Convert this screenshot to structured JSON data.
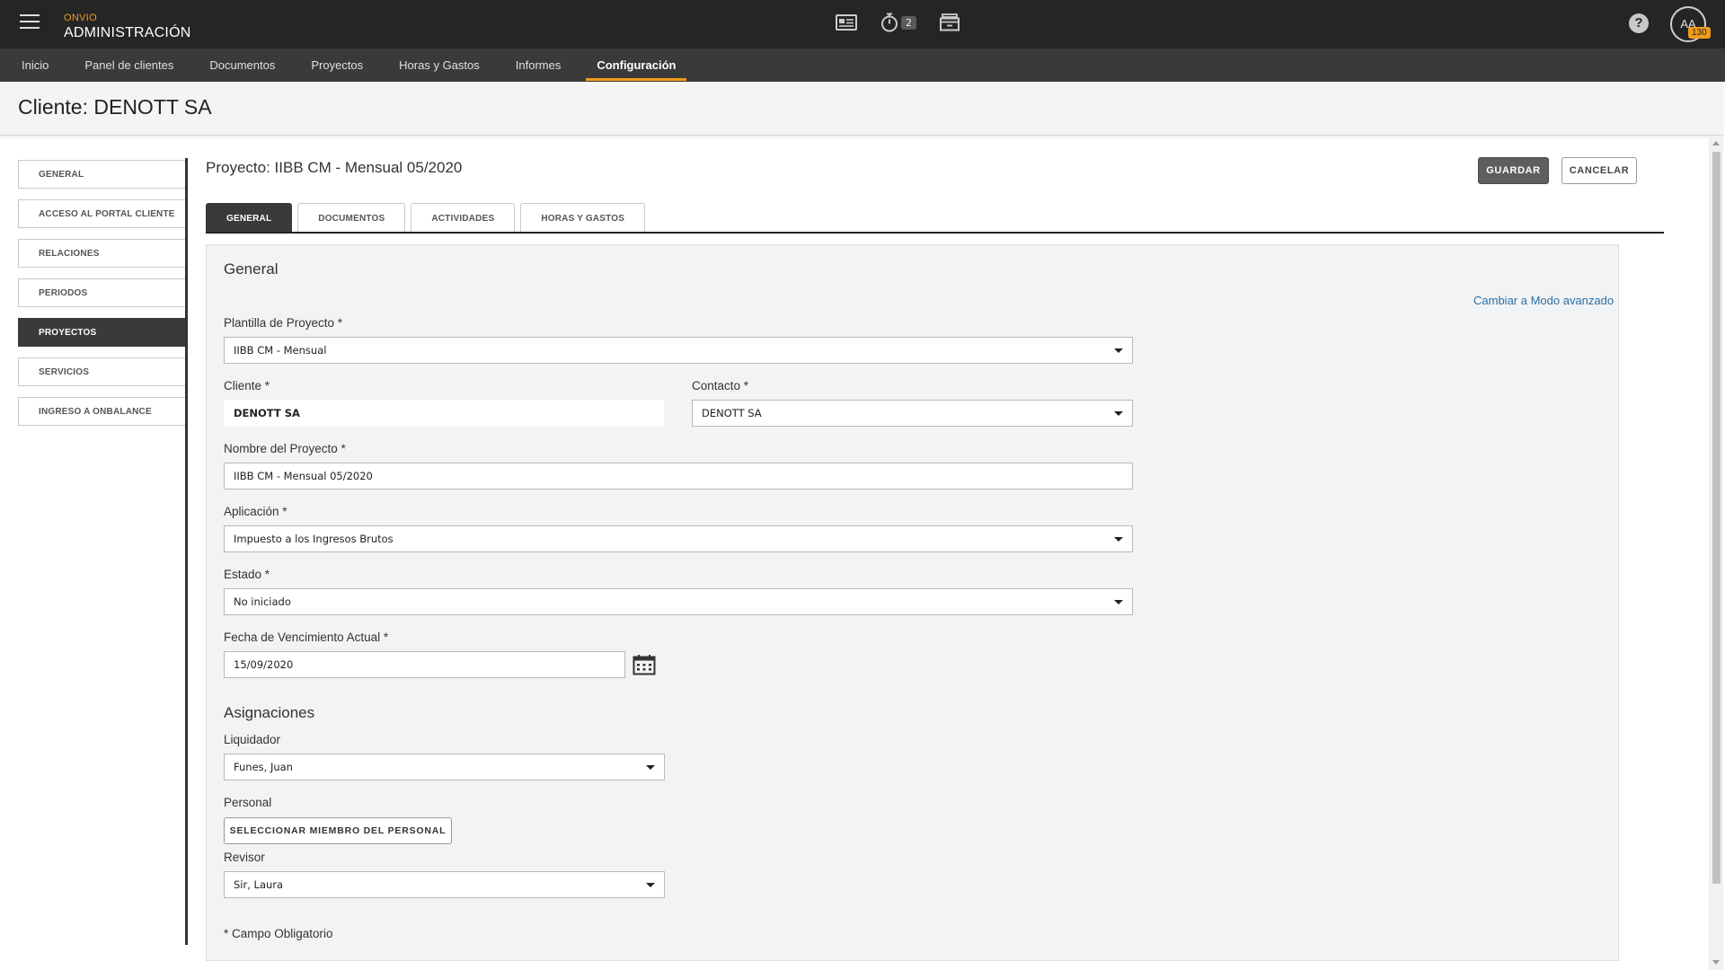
{
  "app": {
    "brand": "ONVIO",
    "module": "ADMINISTRACIÓN",
    "timer_badge": "2",
    "avatar_initials": "AA",
    "avatar_badge": "130",
    "help_symbol": "?"
  },
  "nav": [
    {
      "label": "Inicio"
    },
    {
      "label": "Panel de clientes"
    },
    {
      "label": "Documentos"
    },
    {
      "label": "Proyectos"
    },
    {
      "label": "Horas y Gastos"
    },
    {
      "label": "Informes"
    },
    {
      "label": "Configuración",
      "active": true
    }
  ],
  "page": {
    "title": "Cliente: DENOTT SA"
  },
  "sidebar": {
    "items": [
      {
        "label": "GENERAL"
      },
      {
        "label": "ACCESO AL PORTAL CLIENTE"
      },
      {
        "label": "RELACIONES"
      },
      {
        "label": "PERIODOS"
      },
      {
        "label": "PROYECTOS",
        "active": true
      },
      {
        "label": "SERVICIOS"
      },
      {
        "label": "INGRESO A ONBALANCE"
      }
    ]
  },
  "project": {
    "title": "Proyecto: IIBB CM - Mensual 05/2020",
    "save_label": "GUARDAR",
    "cancel_label": "CANCELAR"
  },
  "tabs": [
    {
      "label": "GENERAL",
      "active": true
    },
    {
      "label": "DOCUMENTOS"
    },
    {
      "label": "ACTIVIDADES"
    },
    {
      "label": "HORAS Y GASTOS"
    }
  ],
  "form": {
    "section_general": "General",
    "advanced_link": "Cambiar a Modo avanzado",
    "template_label": "Plantilla de Proyecto *",
    "template_value": "IIBB CM - Mensual",
    "client_label": "Cliente *",
    "client_value": "DENOTT SA",
    "contact_label": "Contacto *",
    "contact_value": "DENOTT SA",
    "name_label": "Nombre del Proyecto *",
    "name_value": "IIBB CM - Mensual 05/2020",
    "app_label": "Aplicación *",
    "app_value": "Impuesto a los Ingresos Brutos",
    "state_label": "Estado *",
    "state_value": "No iniciado",
    "due_label": "Fecha de Vencimiento Actual *",
    "due_value": "15/09/2020",
    "section_assign": "Asignaciones",
    "liquidator_label": "Liquidador",
    "liquidator_value": "Funes, Juan",
    "staff_label": "Personal",
    "staff_button": "SELECCIONAR MIEMBRO DEL PERSONAL",
    "reviewer_label": "Revisor",
    "reviewer_value": "Sir, Laura",
    "required_note": "* Campo Obligatorio"
  }
}
